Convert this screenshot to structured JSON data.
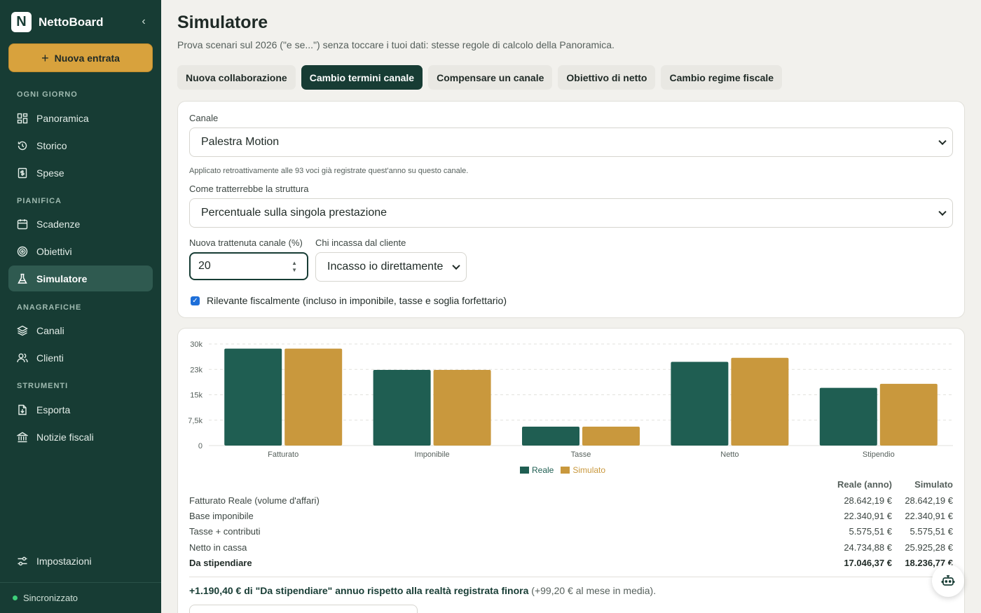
{
  "sidebar": {
    "logo_letter": "N",
    "brand": "NettoBoard",
    "new_entry_label": "Nuova entrata",
    "sections": {
      "daily": "OGNI GIORNO",
      "plan": "PIANIFICA",
      "registry": "ANAGRAFICHE",
      "tools": "STRUMENTI"
    },
    "items": {
      "panoramica": "Panoramica",
      "storico": "Storico",
      "spese": "Spese",
      "scadenze": "Scadenze",
      "obiettivi": "Obiettivi",
      "simulatore": "Simulatore",
      "canali": "Canali",
      "clienti": "Clienti",
      "esporta": "Esporta",
      "notizie": "Notizie fiscali",
      "impostazioni": "Impostazioni"
    },
    "active_item": "Simulatore",
    "sync_status": "Sincronizzato"
  },
  "header": {
    "title": "Simulatore",
    "subtitle": "Prova scenari sul 2026 (\"e se...\") senza toccare i tuoi dati: stesse regole di calcolo della Panoramica."
  },
  "tabs": [
    {
      "label": "Nuova collaborazione",
      "active": false
    },
    {
      "label": "Cambio termini canale",
      "active": true
    },
    {
      "label": "Compensare un canale",
      "active": false
    },
    {
      "label": "Obiettivo di netto",
      "active": false
    },
    {
      "label": "Cambio regime fiscale",
      "active": false
    }
  ],
  "form": {
    "channel_label": "Canale",
    "channel_value": "Palestra Motion",
    "channel_hint": "Applicato retroattivamente alle 93 voci già registrate quest'anno su questo canale.",
    "structure_label": "Come tratterrebbe la struttura",
    "structure_value": "Percentuale sulla singola prestazione",
    "fee_label": "Nuova trattenuta canale (%)",
    "fee_value": "20",
    "collector_label": "Chi incassa dal cliente",
    "collector_value": "Incasso io direttamente",
    "fiscal_checkbox_label": "Rilevante fiscalmente (incluso in imponibile, tasse e soglia forfettario)",
    "fiscal_checked": true
  },
  "chart_data": {
    "type": "bar",
    "categories": [
      "Fatturato",
      "Imponibile",
      "Tasse",
      "Netto",
      "Stipendio"
    ],
    "series": [
      {
        "name": "Reale",
        "values": [
          28642.19,
          22340.91,
          5575.51,
          24734.88,
          17046.37
        ],
        "color": "#1f5e52"
      },
      {
        "name": "Simulato",
        "values": [
          28642.19,
          22340.91,
          5575.51,
          25925.28,
          18236.77
        ],
        "color": "#c9983d"
      }
    ],
    "yticks": [
      "0",
      "7,5k",
      "15k",
      "23k",
      "30k"
    ],
    "ylim": [
      0,
      30000
    ],
    "grid": true,
    "legend": "bottom-center"
  },
  "table": {
    "headers": {
      "real": "Reale (anno)",
      "sim": "Simulato"
    },
    "rows": [
      {
        "label": "Fatturato Reale (volume d'affari)",
        "real": "28.642,19 €",
        "sim": "28.642,19 €",
        "bold": false
      },
      {
        "label": "Base imponibile",
        "real": "22.340,91 €",
        "sim": "22.340,91 €",
        "bold": false
      },
      {
        "label": "Tasse + contributi",
        "real": "5.575,51 €",
        "sim": "5.575,51 €",
        "bold": false
      },
      {
        "label": "Netto in cassa",
        "real": "24.734,88 €",
        "sim": "25.925,28 €",
        "bold": false
      },
      {
        "label": "Da stipendiare",
        "real": "17.046,37 €",
        "sim": "18.236,77 €",
        "bold": true
      }
    ]
  },
  "summary": {
    "strong": "+1.190,40 € di \"Da stipendiare\" annuo rispetto alla realtà registrata finora",
    "rest": "(+99,20 € al mese in media)."
  },
  "colors": {
    "sidebar_bg": "#173c34",
    "accent": "#d8a23d",
    "real": "#1f5e52",
    "simulated": "#c9983d"
  }
}
